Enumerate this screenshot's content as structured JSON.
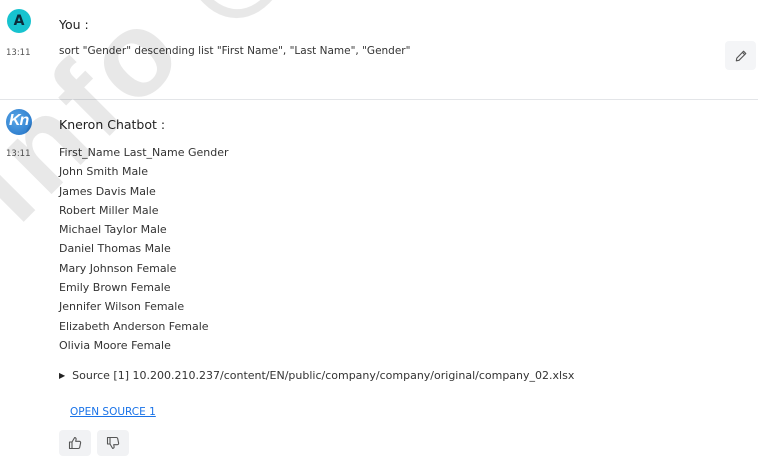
{
  "watermark": {
    "text": "info @ ."
  },
  "user_message": {
    "avatar_letter": "A",
    "sender": "You :",
    "time": "13:11",
    "text": "sort \"Gender\" descending list \"First Name\", \"Last Name\", \"Gender\"",
    "edit_icon": "pencil-icon"
  },
  "bot_message": {
    "avatar_text": "Kn",
    "sender": "Kneron Chatbot :",
    "time": "13:11",
    "lines": [
      "First_Name Last_Name Gender",
      "John Smith Male",
      "James Davis Male",
      "Robert Miller Male",
      "Michael Taylor Male",
      "Daniel Thomas Male",
      "Mary Johnson Female",
      "Emily Brown Female",
      "Jennifer Wilson Female",
      "Elizabeth Anderson Female",
      "Olivia Moore Female"
    ],
    "source_text": "Source [1] 10.200.210.237/content/EN/public/company/company/original/company_02.xlsx",
    "open_source_label": "OPEN SOURCE 1",
    "thumb_up_icon": "thumb-up-icon",
    "thumb_down_icon": "thumb-down-icon"
  },
  "colors": {
    "user_avatar": "#17c3cf",
    "link": "#1a73e8",
    "button_bg": "#f4f5f7"
  }
}
